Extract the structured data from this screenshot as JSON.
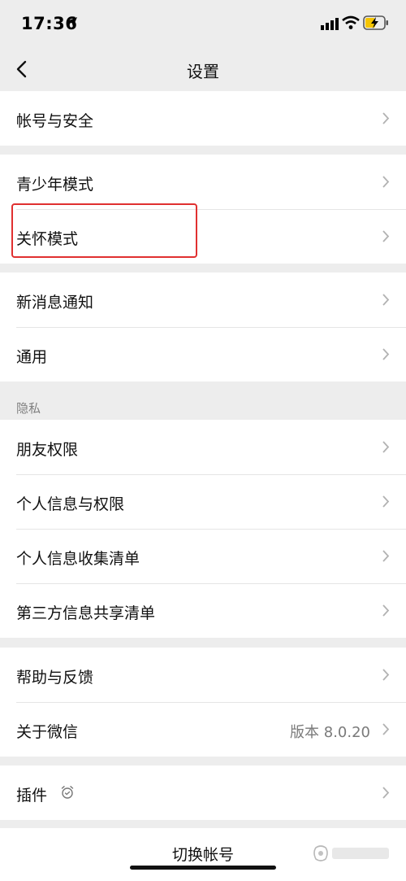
{
  "status_bar": {
    "time": "17:36"
  },
  "nav": {
    "title": "设置"
  },
  "groups": [
    {
      "items": [
        {
          "label": "帐号与安全"
        }
      ]
    },
    {
      "items": [
        {
          "label": "青少年模式"
        },
        {
          "label": "关怀模式"
        }
      ]
    },
    {
      "items": [
        {
          "label": "新消息通知"
        },
        {
          "label": "通用"
        }
      ]
    },
    {
      "section_label": "隐私",
      "items": [
        {
          "label": "朋友权限"
        },
        {
          "label": "个人信息与权限"
        },
        {
          "label": "个人信息收集清单"
        },
        {
          "label": "第三方信息共享清单"
        }
      ]
    },
    {
      "items": [
        {
          "label": "帮助与反馈"
        },
        {
          "label": "关于微信",
          "value": "版本 8.0.20"
        }
      ]
    },
    {
      "items": [
        {
          "label": "插件",
          "icon": "plugin-icon"
        }
      ]
    }
  ],
  "switch_account": {
    "label": "切换帐号"
  },
  "colors": {
    "background": "#ededed",
    "highlight": "#e03030"
  }
}
